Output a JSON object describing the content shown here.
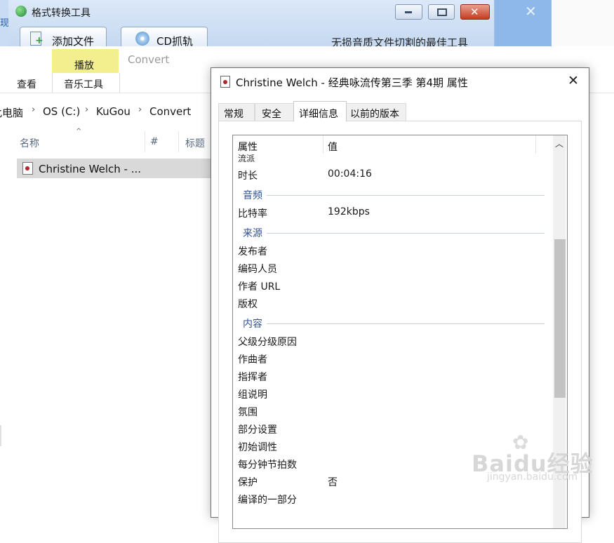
{
  "background": {
    "left_strip_text": "现"
  },
  "converter": {
    "title": "格式转换工具",
    "add_file": "添加文件",
    "cd_rip": "CD抓轨",
    "slogan": "无损音质文件切割的最佳工具"
  },
  "explorer": {
    "ribbon": {
      "context_tab": "播放",
      "context_title": "Convert",
      "view_tab": "查看",
      "music_tools": "音乐工具"
    },
    "breadcrumb": [
      "此电脑",
      "OS (C:)",
      "KuGou",
      "Convert"
    ],
    "columns": {
      "name": "名称",
      "number": "#",
      "title": "标题"
    },
    "file_name": "Christine Welch - ..."
  },
  "dialog": {
    "title": "Christine Welch - 经典咏流传第三季 第4期 属性",
    "tabs": [
      "常规",
      "安全",
      "详细信息",
      "以前的版本"
    ],
    "active_tab": 2,
    "list_header": {
      "property": "属性",
      "value": "值"
    },
    "partial_top": "流派",
    "duration": {
      "label": "时长",
      "value": "00:04:16"
    },
    "group_audio": "音频",
    "bitrate": {
      "label": "比特率",
      "value": "192kbps"
    },
    "group_source": "来源",
    "publisher": "发布者",
    "encoded_by": "编码人员",
    "author_url": "作者 URL",
    "copyright": "版权",
    "group_content": "内容",
    "parental_reason": "父级分级原因",
    "composer": "作曲者",
    "conductor": "指挥者",
    "group_desc": "组说明",
    "mood": "氛围",
    "part_of_set": "部分设置",
    "initial_key": "初始调性",
    "bpm": "每分钟节拍数",
    "protected": {
      "label": "保护",
      "value": "否"
    },
    "partial_bottom": "编译的一部分"
  },
  "watermark": {
    "main": "Baidu经验",
    "sub": "jingyan.baidu.com"
  }
}
